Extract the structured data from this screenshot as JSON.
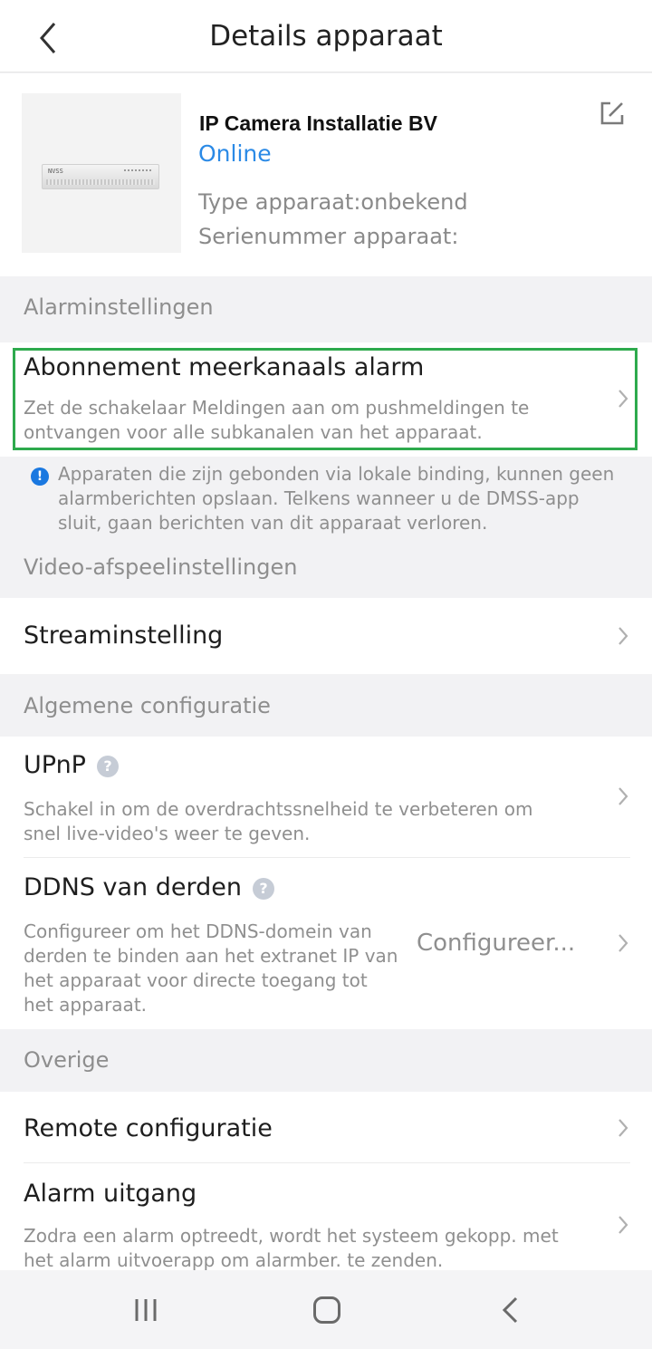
{
  "header": {
    "title": "Details apparaat"
  },
  "device": {
    "name": "IP Camera Installatie BV",
    "status": "Online",
    "type_line": "Type apparaat:onbekend",
    "serial_line": "Serienummer apparaat:",
    "thumb_brand": "NVSS"
  },
  "sections": {
    "alarm": "Alarminstellingen",
    "video": "Video-afspeelinstellingen",
    "general": "Algemene configuratie",
    "other": "Overige"
  },
  "alarm_subscription": {
    "label": "Abonnement meerkanaals alarm",
    "desc_line1": "Zet de schakelaar Meldingen aan om pushmeldingen te",
    "desc_line2": "ontvangen voor alle subkanalen van het apparaat."
  },
  "notice": {
    "icon": "!",
    "line1": "Apparaten die zijn gebonden via lokale binding, kunnen geen",
    "line2": "alarmberichten opslaan. Telkens wanneer u de DMSS-app",
    "line3": "sluit, gaan berichten van dit apparaat verloren."
  },
  "stream": {
    "label": "Streaminstelling"
  },
  "upnp": {
    "label": "UPnP",
    "help": "?",
    "desc_line1": "Schakel in om de overdrachtssnelheid te verbeteren om",
    "desc_line2": "snel live-video's weer te geven."
  },
  "ddns": {
    "label": "DDNS van derden",
    "help": "?",
    "desc_line1": "Configureer om het DDNS-domein van",
    "desc_line2": "derden te binden aan het extranet IP van",
    "desc_line3": "het apparaat voor directe toegang tot",
    "desc_line4": "het apparaat.",
    "value": "Configureer..."
  },
  "remote": {
    "label": "Remote configuratie"
  },
  "alarm_output": {
    "label": "Alarm uitgang",
    "desc_line1": "Zodra een alarm optreedt, wordt het systeem gekopp. met",
    "desc_line2": "het alarm uitvoerapp om alarmber. te zenden."
  },
  "colors": {
    "accent_blue": "#2b8ae6",
    "highlight_green": "#2eaa4d",
    "info_blue": "#1a78e0"
  },
  "icons": {
    "back": "chevron-left-icon",
    "edit": "edit-icon",
    "chevron": "chevron-right-icon",
    "info": "info-icon",
    "help": "help-circle-icon",
    "nav_recent": "recent-apps-icon",
    "nav_home": "home-icon",
    "nav_back": "back-icon"
  }
}
